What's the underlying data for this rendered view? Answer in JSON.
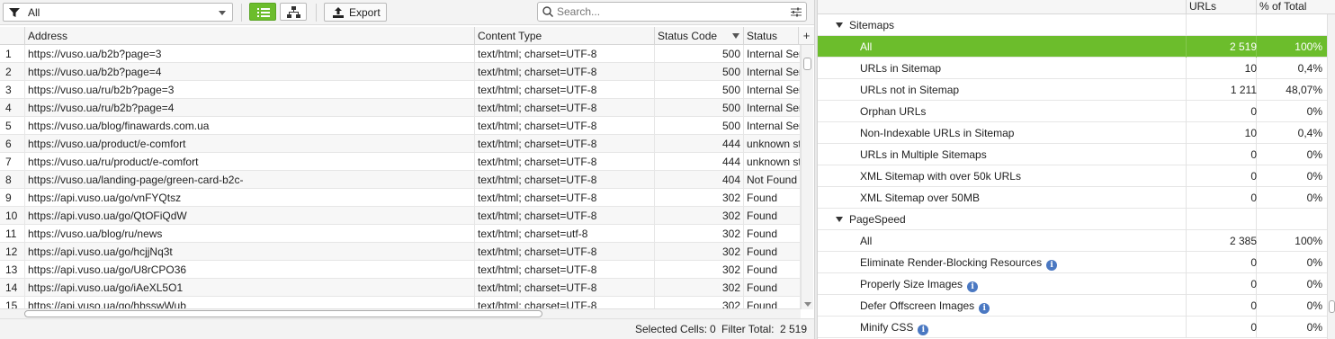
{
  "toolbar": {
    "filter_value": "All",
    "export_label": "Export",
    "search_placeholder": "Search..."
  },
  "grid": {
    "columns": [
      "Address",
      "Content Type",
      "Status Code",
      "Status"
    ],
    "rows": [
      {
        "n": "1",
        "address": "https://vuso.ua/b2b?page=3",
        "content_type": "text/html; charset=UTF-8",
        "status_code": "500",
        "status": "Internal Server Error"
      },
      {
        "n": "2",
        "address": "https://vuso.ua/b2b?page=4",
        "content_type": "text/html; charset=UTF-8",
        "status_code": "500",
        "status": "Internal Server Error"
      },
      {
        "n": "3",
        "address": "https://vuso.ua/ru/b2b?page=3",
        "content_type": "text/html; charset=UTF-8",
        "status_code": "500",
        "status": "Internal Server Error"
      },
      {
        "n": "4",
        "address": "https://vuso.ua/ru/b2b?page=4",
        "content_type": "text/html; charset=UTF-8",
        "status_code": "500",
        "status": "Internal Server Error"
      },
      {
        "n": "5",
        "address": "https://vuso.ua/blog/finawards.com.ua",
        "content_type": "text/html; charset=UTF-8",
        "status_code": "500",
        "status": "Internal Server Error"
      },
      {
        "n": "6",
        "address": "https://vuso.ua/product/e-comfort",
        "content_type": "text/html; charset=UTF-8",
        "status_code": "444",
        "status": "unknown status"
      },
      {
        "n": "7",
        "address": "https://vuso.ua/ru/product/e-comfort",
        "content_type": "text/html; charset=UTF-8",
        "status_code": "444",
        "status": "unknown status"
      },
      {
        "n": "8",
        "address": "https://vuso.ua/landing-page/green-card-b2c-",
        "content_type": "text/html; charset=UTF-8",
        "status_code": "404",
        "status": "Not Found"
      },
      {
        "n": "9",
        "address": "https://api.vuso.ua/go/vnFYQtsz",
        "content_type": "text/html; charset=UTF-8",
        "status_code": "302",
        "status": "Found"
      },
      {
        "n": "10",
        "address": "https://api.vuso.ua/go/QtOFiQdW",
        "content_type": "text/html; charset=UTF-8",
        "status_code": "302",
        "status": "Found"
      },
      {
        "n": "11",
        "address": "https://vuso.ua/blog/ru/news",
        "content_type": "text/html; charset=utf-8",
        "status_code": "302",
        "status": "Found"
      },
      {
        "n": "12",
        "address": "https://api.vuso.ua/go/hcjjNq3t",
        "content_type": "text/html; charset=UTF-8",
        "status_code": "302",
        "status": "Found"
      },
      {
        "n": "13",
        "address": "https://api.vuso.ua/go/U8rCPO36",
        "content_type": "text/html; charset=UTF-8",
        "status_code": "302",
        "status": "Found"
      },
      {
        "n": "14",
        "address": "https://api.vuso.ua/go/iAeXL5O1",
        "content_type": "text/html; charset=UTF-8",
        "status_code": "302",
        "status": "Found"
      },
      {
        "n": "15",
        "address": "https://api.vuso.ua/go/hbsswWub",
        "content_type": "text/html; charset=UTF-8",
        "status_code": "302",
        "status": "Found"
      }
    ]
  },
  "statusbar": {
    "selected_label": "Selected Cells:",
    "selected_value": "0",
    "filter_label": "Filter Total:",
    "filter_value": "2 519"
  },
  "overview": {
    "columns": [
      "URLs",
      "% of Total"
    ],
    "rows": [
      {
        "type": "group",
        "label": "Sitemaps",
        "urls": "",
        "pct": "",
        "info": false,
        "selected": false
      },
      {
        "type": "item",
        "label": "All",
        "urls": "2 519",
        "pct": "100%",
        "info": false,
        "selected": true
      },
      {
        "type": "item",
        "label": "URLs in Sitemap",
        "urls": "10",
        "pct": "0,4%",
        "info": false,
        "selected": false
      },
      {
        "type": "item",
        "label": "URLs not in Sitemap",
        "urls": "1 211",
        "pct": "48,07%",
        "info": false,
        "selected": false
      },
      {
        "type": "item",
        "label": "Orphan URLs",
        "urls": "0",
        "pct": "0%",
        "info": false,
        "selected": false
      },
      {
        "type": "item",
        "label": "Non-Indexable URLs in Sitemap",
        "urls": "10",
        "pct": "0,4%",
        "info": false,
        "selected": false
      },
      {
        "type": "item",
        "label": "URLs in Multiple Sitemaps",
        "urls": "0",
        "pct": "0%",
        "info": false,
        "selected": false
      },
      {
        "type": "item",
        "label": "XML Sitemap with over 50k URLs",
        "urls": "0",
        "pct": "0%",
        "info": false,
        "selected": false
      },
      {
        "type": "item",
        "label": "XML Sitemap over 50MB",
        "urls": "0",
        "pct": "0%",
        "info": false,
        "selected": false
      },
      {
        "type": "group",
        "label": "PageSpeed",
        "urls": "",
        "pct": "",
        "info": false,
        "selected": false
      },
      {
        "type": "item",
        "label": "All",
        "urls": "2 385",
        "pct": "100%",
        "info": false,
        "selected": false
      },
      {
        "type": "item",
        "label": "Eliminate Render-Blocking Resources",
        "urls": "0",
        "pct": "0%",
        "info": true,
        "selected": false
      },
      {
        "type": "item",
        "label": "Properly Size Images",
        "urls": "0",
        "pct": "0%",
        "info": true,
        "selected": false
      },
      {
        "type": "item",
        "label": "Defer Offscreen Images",
        "urls": "0",
        "pct": "0%",
        "info": true,
        "selected": false
      },
      {
        "type": "item",
        "label": "Minify CSS",
        "urls": "0",
        "pct": "0%",
        "info": true,
        "selected": false
      }
    ]
  },
  "colors": {
    "accent": "#6cbd2c",
    "info_icon": "#4a78c2"
  }
}
